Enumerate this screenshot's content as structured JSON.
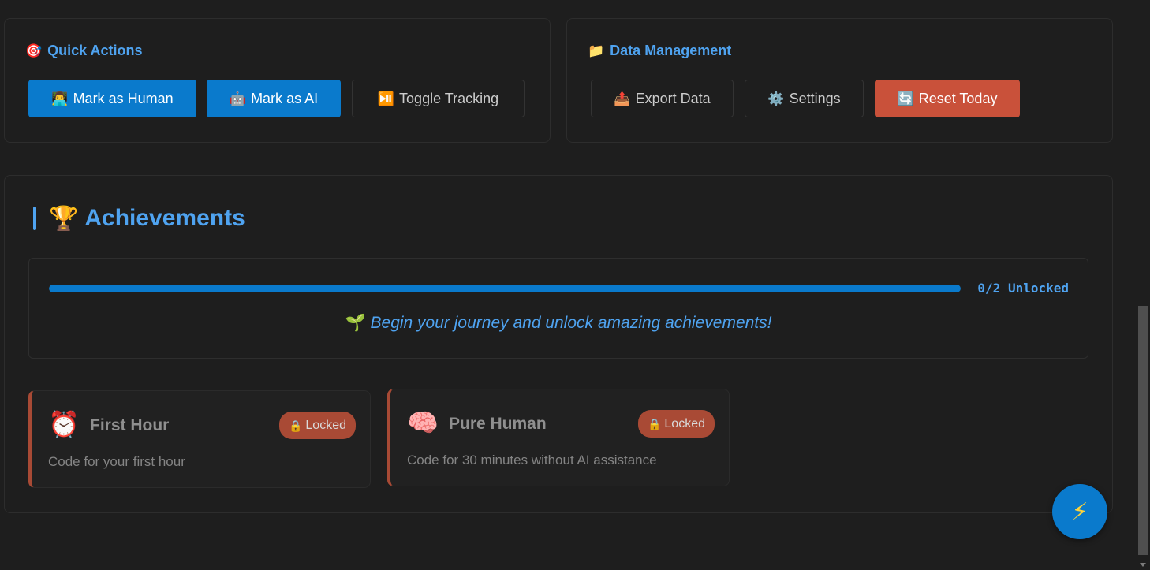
{
  "quick_actions": {
    "icon": "target-icon",
    "title": "Quick Actions",
    "mark_human_label": "Mark as Human",
    "mark_human_icon": "technologist-icon",
    "mark_ai_label": "Mark as AI",
    "mark_ai_icon": "robot-icon",
    "toggle_label": "Toggle Tracking",
    "toggle_icon": "play-pause-icon"
  },
  "data_management": {
    "icon": "folder-icon",
    "title": "Data Management",
    "export_label": "Export Data",
    "export_icon": "outbox-tray-icon",
    "settings_label": "Settings",
    "settings_icon": "gear-icon",
    "reset_label": "Reset Today",
    "reset_icon": "refresh-icon"
  },
  "achievements": {
    "title": "Achievements",
    "title_icon": "trophy-icon",
    "progress_fraction": 1.0,
    "progress_text": "0/2 Unlocked",
    "journey_icon": "seedling-icon",
    "journey_text": "Begin your journey and unlock amazing achievements!",
    "items": [
      {
        "icon": "alarm-clock-icon",
        "name": "First Hour",
        "status": "Locked",
        "status_icon": "lock-icon",
        "description": "Code for your first hour"
      },
      {
        "icon": "brain-icon",
        "name": "Pure Human",
        "status": "Locked",
        "status_icon": "lock-icon",
        "description": "Code for 30 minutes without AI assistance"
      }
    ]
  },
  "fab": {
    "icon": "lightning-icon"
  },
  "colors": {
    "accent": "#4fa3f0",
    "primary": "#0a7acc",
    "danger": "#c9513a",
    "locked": "#a94a35"
  }
}
